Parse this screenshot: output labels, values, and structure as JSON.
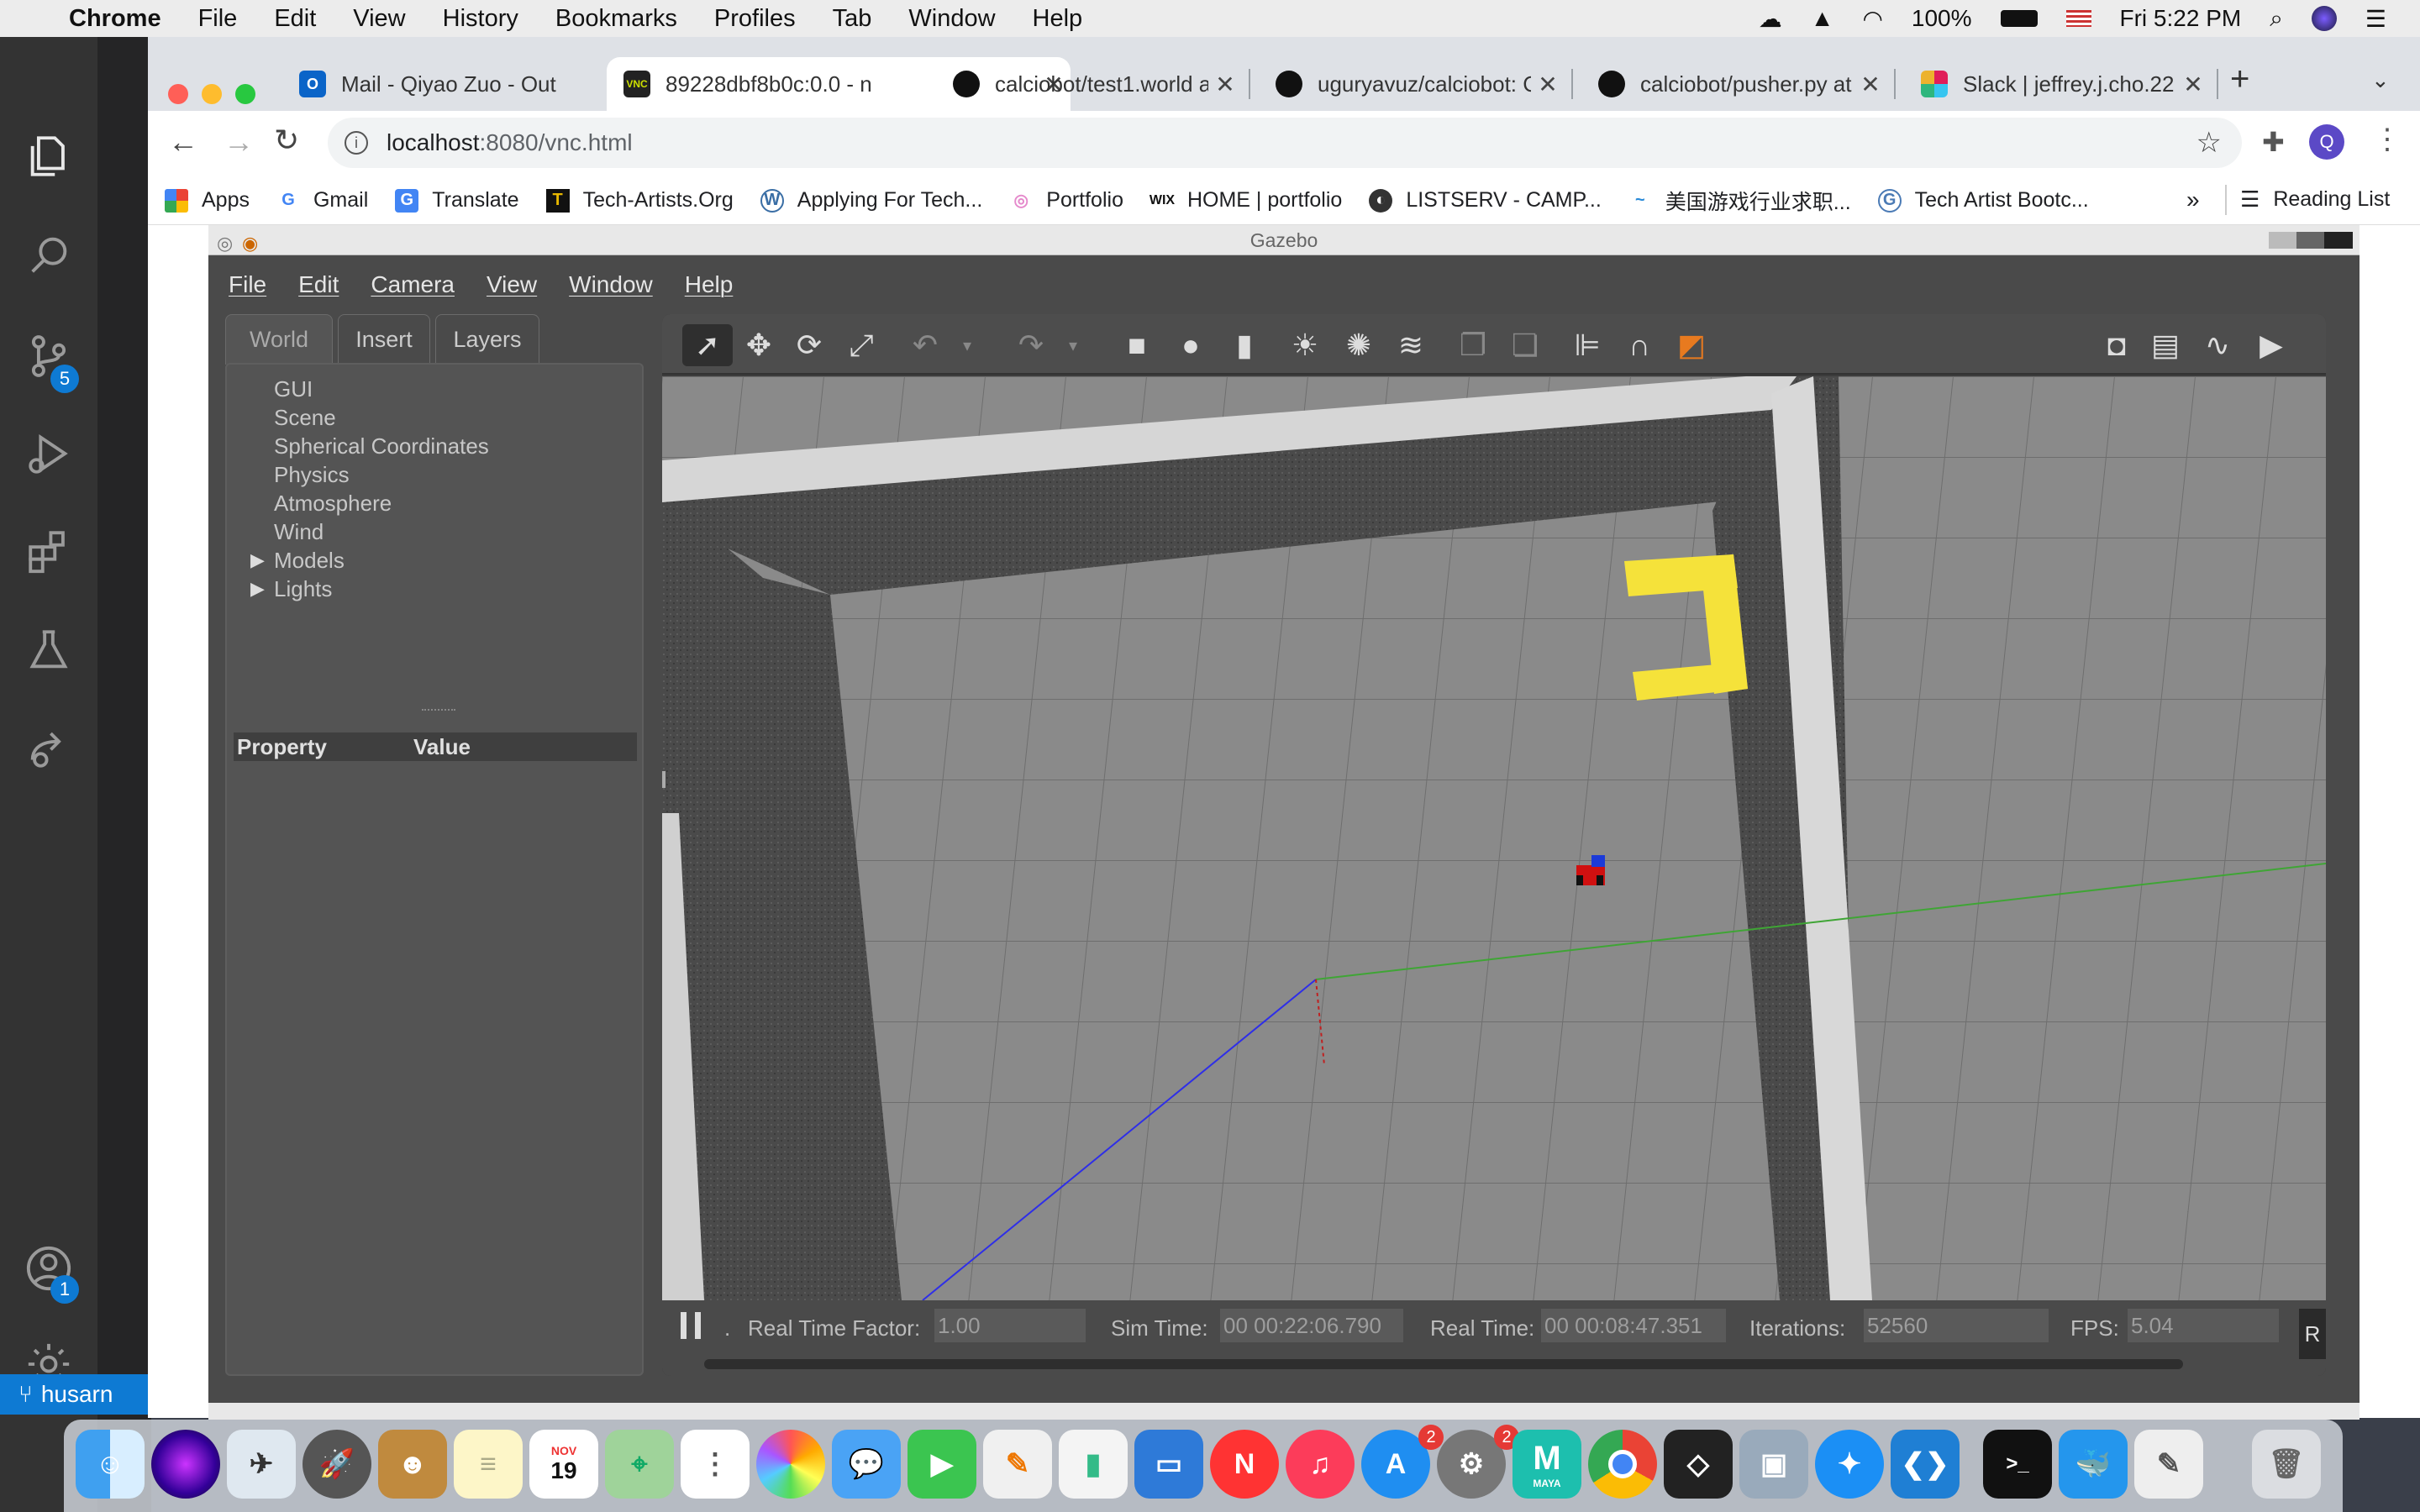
{
  "menubar": {
    "app_name": "Chrome",
    "items": [
      "File",
      "Edit",
      "View",
      "History",
      "Bookmarks",
      "Profiles",
      "Tab",
      "Window",
      "Help"
    ],
    "battery": "100%",
    "clock": "Fri 5:22 PM"
  },
  "vscode": {
    "badges": {
      "source_control": "5",
      "accounts": "1"
    },
    "status_text": "husarn"
  },
  "chrome": {
    "tabs": [
      {
        "title": "Mail - Qiyao Zuo - Out",
        "icon": "outlook-icon"
      },
      {
        "title": "89228dbf8b0c:0.0 - n",
        "icon": "vnc-icon"
      },
      {
        "title": "calciobot/test1.world a",
        "icon": "github-icon"
      },
      {
        "title": "uguryavuz/calciobot: C",
        "icon": "github-icon"
      },
      {
        "title": "calciobot/pusher.py at",
        "icon": "github-icon"
      },
      {
        "title": "Slack | jeffrey.j.cho.22",
        "icon": "slack-icon"
      }
    ],
    "new_tab": "+",
    "address": {
      "host": "localhost",
      "rest": ":8080/vnc.html"
    },
    "bookmarks": [
      "Apps",
      "Gmail",
      "Translate",
      "Tech-Artists.Org",
      "Applying For Tech...",
      "Portfolio",
      "HOME | portfolio",
      "LISTSERV - CAMP...",
      "美国游戏行业求职...",
      "Tech Artist Bootc..."
    ],
    "more": "»",
    "reading_list": "Reading List",
    "profile_initial": "Q"
  },
  "gazebo": {
    "title": "Gazebo",
    "menu": [
      "File",
      "Edit",
      "Camera",
      "View",
      "Window",
      "Help"
    ],
    "tabs": [
      "World",
      "Insert",
      "Layers"
    ],
    "tree": [
      "GUI",
      "Scene",
      "Spherical Coordinates",
      "Physics",
      "Atmosphere",
      "Wind",
      "Models",
      "Lights"
    ],
    "property_header": "Property",
    "value_header": "Value",
    "status": {
      "rtf_label": "Real Time Factor:",
      "rtf": "1.00",
      "sim_label": "Sim Time:",
      "sim": "00 00:22:06.790",
      "real_label": "Real Time:",
      "real": "00 00:08:47.351",
      "iter_label": "Iterations:",
      "iter": "52560",
      "fps_label": "FPS:",
      "fps": "5.04",
      "reset": "R"
    }
  },
  "dock": {
    "calendar_month": "NOV",
    "calendar_day": "19",
    "badges": {
      "appstore": "2",
      "prefs": "2"
    },
    "maya_label": "MAYA"
  }
}
